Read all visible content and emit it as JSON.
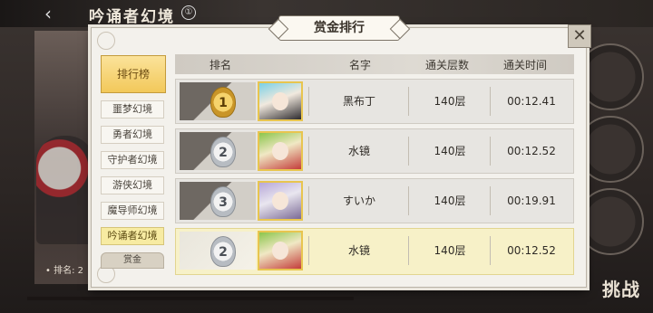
{
  "background": {
    "title": "吟诵者幻境",
    "info_icon": "①",
    "rank_label": "• 排名: 2",
    "challenge_label": "挑战"
  },
  "dialog": {
    "title": "赏金排行",
    "close_icon": "✕"
  },
  "tabs": {
    "main": "排行榜",
    "items": [
      "噩梦幻境",
      "勇者幻境",
      "守护者幻境",
      "游侠幻境",
      "魔导师幻境",
      "吟诵者幻境"
    ],
    "active_index": 5,
    "more": "赏金"
  },
  "table": {
    "headers": {
      "rank": "排名",
      "name": "名字",
      "floors": "通关层数",
      "time": "通关时间"
    },
    "rows": [
      {
        "rank": "1",
        "name": "黑布丁",
        "floors": "140层",
        "time": "00:12.41",
        "badge": "gold"
      },
      {
        "rank": "2",
        "name": "水镜",
        "floors": "140层",
        "time": "00:12.52",
        "badge": "silver"
      },
      {
        "rank": "3",
        "name": "すいか",
        "floors": "140层",
        "time": "00:19.91",
        "badge": "silver"
      },
      {
        "rank": "2",
        "name": "水镜",
        "floors": "140层",
        "time": "00:12.52",
        "badge": "silver"
      }
    ]
  },
  "colors": {
    "highlight_row": "#f7f1c8",
    "active_tab": "#f7eba2",
    "main_tab": "#f2c85a"
  }
}
